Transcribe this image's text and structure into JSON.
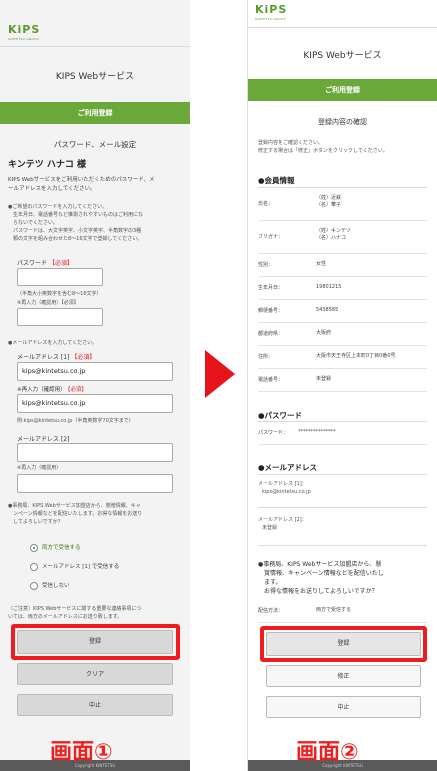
{
  "common": {
    "logo": "KiPS",
    "logo_sub": "KINTETSU GROUP",
    "service_title": "KIPS Webサービス",
    "footer": "Copyright KINTETSU"
  },
  "screen1": {
    "green_bar": "ご利用登録",
    "subtitle": "パスワード、メール設定",
    "member_name": "キンテツ ハナコ 様",
    "intro": [
      "KIPS Webサービスをご利用いただくためのパスワード、メ",
      "ールアドレスを入力してください。"
    ],
    "pw_notes": [
      "●ご希望のパスワードを入力してください。",
      "　生年月日、電話番号など推測されやすいものはご利用にな",
      "　らないでください。",
      "　パスワードは、大文字英字、小文字英字、半角数字の3種",
      "　類の文字を組み合わせた8〜16文字で登録してください。"
    ],
    "password_label": "パスワード",
    "required": "【必須】",
    "pw_hint": "（半角大小英数字を含む8〜16文字）",
    "pw_confirm_label": "※再入力（確認用）【必須】",
    "mail_note": "●メールアドレスを入力してください。",
    "mail1_label": "メールアドレス [1]",
    "mail1_value": "kips@kintetsu.co.jp",
    "mail1_confirm_label": "※再入力（確認用）",
    "mail1_confirm_value": "kips@kintetsu.co.jp",
    "mail_example": "例:kips@kintetsu.co.jp（半角英数字70文字まで）",
    "mail2_label": "メールアドレス [2]",
    "mail2_confirm_label": "※再入力（確認用）",
    "info_question": [
      "●事務局、KIPS Webサービス加盟店から、慈贈情報、キャ",
      "　ンペーン情報などを配信いたします。お得な情報をお送り",
      "　してよろしいですか？"
    ],
    "radio": [
      "両方で受信する",
      "メールアドレス [1] で受信する",
      "受信しない"
    ],
    "notice": [
      "（ご注意）KIPS Webサービスに関する重要な連絡事項につ",
      "いては、両方のメールアドレスにお送り致します。"
    ],
    "btn_register": "登録",
    "btn_clear": "クリア",
    "btn_cancel": "中止",
    "caption": "画面①"
  },
  "screen2": {
    "green_bar": "ご利用登録",
    "subtitle": "登録内容の確認",
    "intro": [
      "登録内容をご確認ください。",
      "修正する場合は「修正」ボタンをクリックしてください。"
    ],
    "member_heading": "●会員情報",
    "rows": [
      {
        "key": "氏名：",
        "v1": "（姓）近鉄",
        "v2": "（名）華子"
      },
      {
        "key": "フリガナ：",
        "v1": "（姓）キンテツ",
        "v2": "（名）ハナコ"
      },
      {
        "key": "性別：",
        "v1": "女性",
        "v2": ""
      },
      {
        "key": "生年月日：",
        "v1": "19801215",
        "v2": ""
      },
      {
        "key": "郵便番号：",
        "v1": "5438585",
        "v2": ""
      },
      {
        "key": "都道府県：",
        "v1": "大阪府",
        "v2": ""
      },
      {
        "key": "住所：",
        "v1": "大阪市天王寺区上本町0丁目0番0号",
        "v2": ""
      },
      {
        "key": "電話番号：",
        "v1": "未登録",
        "v2": ""
      }
    ],
    "pw_heading": "●パスワード",
    "pw_key": "パスワード：",
    "pw_value": "***************",
    "mail_heading": "●メールアドレス",
    "mail1_key": "メールアドレス [1]：",
    "mail1_value": "kips@kintetsu.co.jp",
    "mail2_key": "メールアドレス [2]：",
    "mail2_value": "未登録",
    "info_question": [
      "●事務局、KIPS Webサービス加盟店から、懸",
      "　賞情報、キャンペーン情報などを配信いたし",
      "　ます。",
      "　お得な情報をお送りしてよろしいですか？"
    ],
    "delivery_key": "配信方法：",
    "delivery_value": "両方で受信する",
    "btn_register": "登録",
    "btn_fix": "修正",
    "btn_cancel": "中止",
    "caption": "画面②"
  }
}
